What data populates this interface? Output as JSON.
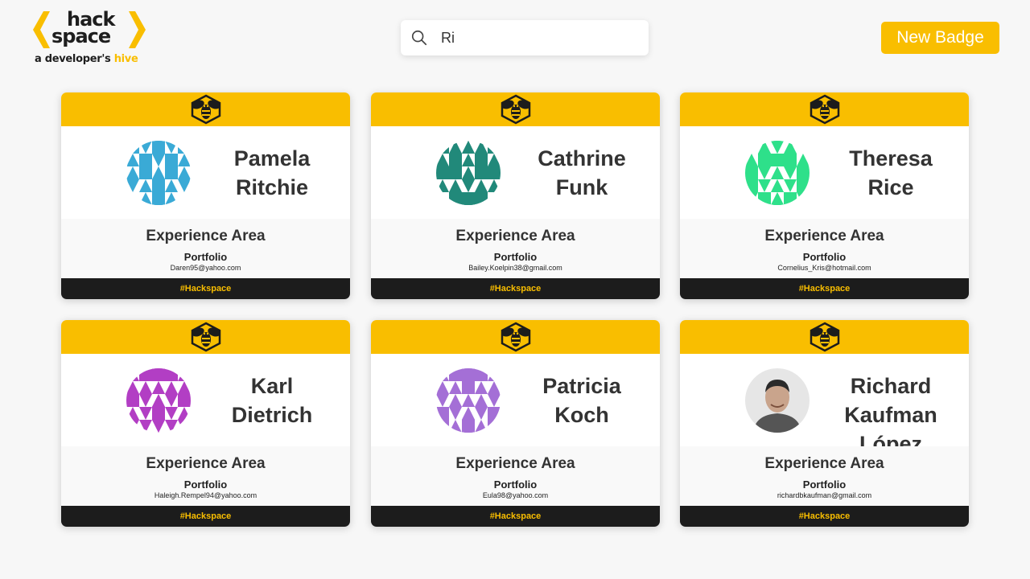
{
  "logo": {
    "line1": "hack",
    "line2": "space",
    "tag_prefix": "a developer's ",
    "tag_highlight": "hive"
  },
  "search": {
    "value": "Ri",
    "icon": "search-icon"
  },
  "new_badge_label": "New Badge",
  "colors": {
    "accent": "#f9be00",
    "footer": "#1c1c1c",
    "background": "#f7f7f7"
  },
  "badges": [
    {
      "first": "Pamela",
      "last": "Ritchie",
      "area": "Experience Area",
      "portfolio": "Portfolio",
      "email": "Daren95@yahoo.com",
      "tag": "#Hackspace",
      "avatar_color": "#3aaad6",
      "avatar_type": "identicon"
    },
    {
      "first": "Cathrine",
      "last": "Funk",
      "area": "Experience Area",
      "portfolio": "Portfolio",
      "email": "Bailey.Koelpin38@gmail.com",
      "tag": "#Hackspace",
      "avatar_color": "#21897a",
      "avatar_type": "identicon"
    },
    {
      "first": "Theresa",
      "last": "Rice",
      "area": "Experience Area",
      "portfolio": "Portfolio",
      "email": "Cornelius_Kris@hotmail.com",
      "tag": "#Hackspace",
      "avatar_color": "#2ee08a",
      "avatar_type": "identicon"
    },
    {
      "first": "Karl",
      "last": "Dietrich",
      "area": "Experience Area",
      "portfolio": "Portfolio",
      "email": "Haleigh.Rempel94@yahoo.com",
      "tag": "#Hackspace",
      "avatar_color": "#b23ec4",
      "avatar_type": "identicon"
    },
    {
      "first": "Patricia",
      "last": "Koch",
      "area": "Experience Area",
      "portfolio": "Portfolio",
      "email": "Eula98@yahoo.com",
      "tag": "#Hackspace",
      "avatar_color": "#a46fd6",
      "avatar_type": "identicon"
    },
    {
      "first": "Richard",
      "last": "Kaufman López",
      "area": "Experience Area",
      "portfolio": "Portfolio",
      "email": "richardbkaufman@gmail.com",
      "tag": "#Hackspace",
      "avatar_color": "#8a8a8a",
      "avatar_type": "photo"
    }
  ]
}
